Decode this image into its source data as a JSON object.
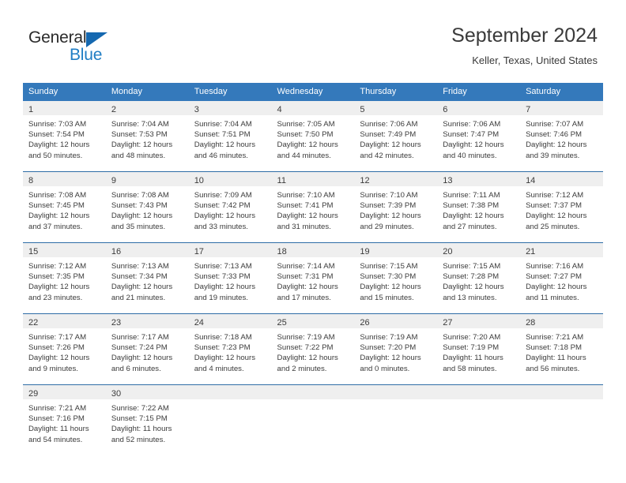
{
  "brand": {
    "name_part1": "General",
    "name_part2": "Blue",
    "color_dark": "#2b2b2b",
    "color_blue": "#1f7dc4",
    "triangle_color": "#1568b0"
  },
  "header": {
    "title": "September 2024",
    "subtitle": "Keller, Texas, United States"
  },
  "theme": {
    "header_row_bg": "#3479bb",
    "header_row_text": "#ffffff",
    "day_band_bg": "#efefef",
    "row_border": "#2e6da6",
    "body_text": "#3b3b3b"
  },
  "weekday_headers": [
    "Sunday",
    "Monday",
    "Tuesday",
    "Wednesday",
    "Thursday",
    "Friday",
    "Saturday"
  ],
  "weeks": [
    [
      {
        "day": "1",
        "sunrise": "Sunrise: 7:03 AM",
        "sunset": "Sunset: 7:54 PM",
        "daylight_line1": "Daylight: 12 hours",
        "daylight_line2": "and 50 minutes."
      },
      {
        "day": "2",
        "sunrise": "Sunrise: 7:04 AM",
        "sunset": "Sunset: 7:53 PM",
        "daylight_line1": "Daylight: 12 hours",
        "daylight_line2": "and 48 minutes."
      },
      {
        "day": "3",
        "sunrise": "Sunrise: 7:04 AM",
        "sunset": "Sunset: 7:51 PM",
        "daylight_line1": "Daylight: 12 hours",
        "daylight_line2": "and 46 minutes."
      },
      {
        "day": "4",
        "sunrise": "Sunrise: 7:05 AM",
        "sunset": "Sunset: 7:50 PM",
        "daylight_line1": "Daylight: 12 hours",
        "daylight_line2": "and 44 minutes."
      },
      {
        "day": "5",
        "sunrise": "Sunrise: 7:06 AM",
        "sunset": "Sunset: 7:49 PM",
        "daylight_line1": "Daylight: 12 hours",
        "daylight_line2": "and 42 minutes."
      },
      {
        "day": "6",
        "sunrise": "Sunrise: 7:06 AM",
        "sunset": "Sunset: 7:47 PM",
        "daylight_line1": "Daylight: 12 hours",
        "daylight_line2": "and 40 minutes."
      },
      {
        "day": "7",
        "sunrise": "Sunrise: 7:07 AM",
        "sunset": "Sunset: 7:46 PM",
        "daylight_line1": "Daylight: 12 hours",
        "daylight_line2": "and 39 minutes."
      }
    ],
    [
      {
        "day": "8",
        "sunrise": "Sunrise: 7:08 AM",
        "sunset": "Sunset: 7:45 PM",
        "daylight_line1": "Daylight: 12 hours",
        "daylight_line2": "and 37 minutes."
      },
      {
        "day": "9",
        "sunrise": "Sunrise: 7:08 AM",
        "sunset": "Sunset: 7:43 PM",
        "daylight_line1": "Daylight: 12 hours",
        "daylight_line2": "and 35 minutes."
      },
      {
        "day": "10",
        "sunrise": "Sunrise: 7:09 AM",
        "sunset": "Sunset: 7:42 PM",
        "daylight_line1": "Daylight: 12 hours",
        "daylight_line2": "and 33 minutes."
      },
      {
        "day": "11",
        "sunrise": "Sunrise: 7:10 AM",
        "sunset": "Sunset: 7:41 PM",
        "daylight_line1": "Daylight: 12 hours",
        "daylight_line2": "and 31 minutes."
      },
      {
        "day": "12",
        "sunrise": "Sunrise: 7:10 AM",
        "sunset": "Sunset: 7:39 PM",
        "daylight_line1": "Daylight: 12 hours",
        "daylight_line2": "and 29 minutes."
      },
      {
        "day": "13",
        "sunrise": "Sunrise: 7:11 AM",
        "sunset": "Sunset: 7:38 PM",
        "daylight_line1": "Daylight: 12 hours",
        "daylight_line2": "and 27 minutes."
      },
      {
        "day": "14",
        "sunrise": "Sunrise: 7:12 AM",
        "sunset": "Sunset: 7:37 PM",
        "daylight_line1": "Daylight: 12 hours",
        "daylight_line2": "and 25 minutes."
      }
    ],
    [
      {
        "day": "15",
        "sunrise": "Sunrise: 7:12 AM",
        "sunset": "Sunset: 7:35 PM",
        "daylight_line1": "Daylight: 12 hours",
        "daylight_line2": "and 23 minutes."
      },
      {
        "day": "16",
        "sunrise": "Sunrise: 7:13 AM",
        "sunset": "Sunset: 7:34 PM",
        "daylight_line1": "Daylight: 12 hours",
        "daylight_line2": "and 21 minutes."
      },
      {
        "day": "17",
        "sunrise": "Sunrise: 7:13 AM",
        "sunset": "Sunset: 7:33 PM",
        "daylight_line1": "Daylight: 12 hours",
        "daylight_line2": "and 19 minutes."
      },
      {
        "day": "18",
        "sunrise": "Sunrise: 7:14 AM",
        "sunset": "Sunset: 7:31 PM",
        "daylight_line1": "Daylight: 12 hours",
        "daylight_line2": "and 17 minutes."
      },
      {
        "day": "19",
        "sunrise": "Sunrise: 7:15 AM",
        "sunset": "Sunset: 7:30 PM",
        "daylight_line1": "Daylight: 12 hours",
        "daylight_line2": "and 15 minutes."
      },
      {
        "day": "20",
        "sunrise": "Sunrise: 7:15 AM",
        "sunset": "Sunset: 7:28 PM",
        "daylight_line1": "Daylight: 12 hours",
        "daylight_line2": "and 13 minutes."
      },
      {
        "day": "21",
        "sunrise": "Sunrise: 7:16 AM",
        "sunset": "Sunset: 7:27 PM",
        "daylight_line1": "Daylight: 12 hours",
        "daylight_line2": "and 11 minutes."
      }
    ],
    [
      {
        "day": "22",
        "sunrise": "Sunrise: 7:17 AM",
        "sunset": "Sunset: 7:26 PM",
        "daylight_line1": "Daylight: 12 hours",
        "daylight_line2": "and 9 minutes."
      },
      {
        "day": "23",
        "sunrise": "Sunrise: 7:17 AM",
        "sunset": "Sunset: 7:24 PM",
        "daylight_line1": "Daylight: 12 hours",
        "daylight_line2": "and 6 minutes."
      },
      {
        "day": "24",
        "sunrise": "Sunrise: 7:18 AM",
        "sunset": "Sunset: 7:23 PM",
        "daylight_line1": "Daylight: 12 hours",
        "daylight_line2": "and 4 minutes."
      },
      {
        "day": "25",
        "sunrise": "Sunrise: 7:19 AM",
        "sunset": "Sunset: 7:22 PM",
        "daylight_line1": "Daylight: 12 hours",
        "daylight_line2": "and 2 minutes."
      },
      {
        "day": "26",
        "sunrise": "Sunrise: 7:19 AM",
        "sunset": "Sunset: 7:20 PM",
        "daylight_line1": "Daylight: 12 hours",
        "daylight_line2": "and 0 minutes."
      },
      {
        "day": "27",
        "sunrise": "Sunrise: 7:20 AM",
        "sunset": "Sunset: 7:19 PM",
        "daylight_line1": "Daylight: 11 hours",
        "daylight_line2": "and 58 minutes."
      },
      {
        "day": "28",
        "sunrise": "Sunrise: 7:21 AM",
        "sunset": "Sunset: 7:18 PM",
        "daylight_line1": "Daylight: 11 hours",
        "daylight_line2": "and 56 minutes."
      }
    ],
    [
      {
        "day": "29",
        "sunrise": "Sunrise: 7:21 AM",
        "sunset": "Sunset: 7:16 PM",
        "daylight_line1": "Daylight: 11 hours",
        "daylight_line2": "and 54 minutes."
      },
      {
        "day": "30",
        "sunrise": "Sunrise: 7:22 AM",
        "sunset": "Sunset: 7:15 PM",
        "daylight_line1": "Daylight: 11 hours",
        "daylight_line2": "and 52 minutes."
      },
      {
        "day": "",
        "sunrise": "",
        "sunset": "",
        "daylight_line1": "",
        "daylight_line2": ""
      },
      {
        "day": "",
        "sunrise": "",
        "sunset": "",
        "daylight_line1": "",
        "daylight_line2": ""
      },
      {
        "day": "",
        "sunrise": "",
        "sunset": "",
        "daylight_line1": "",
        "daylight_line2": ""
      },
      {
        "day": "",
        "sunrise": "",
        "sunset": "",
        "daylight_line1": "",
        "daylight_line2": ""
      },
      {
        "day": "",
        "sunrise": "",
        "sunset": "",
        "daylight_line1": "",
        "daylight_line2": ""
      }
    ]
  ]
}
